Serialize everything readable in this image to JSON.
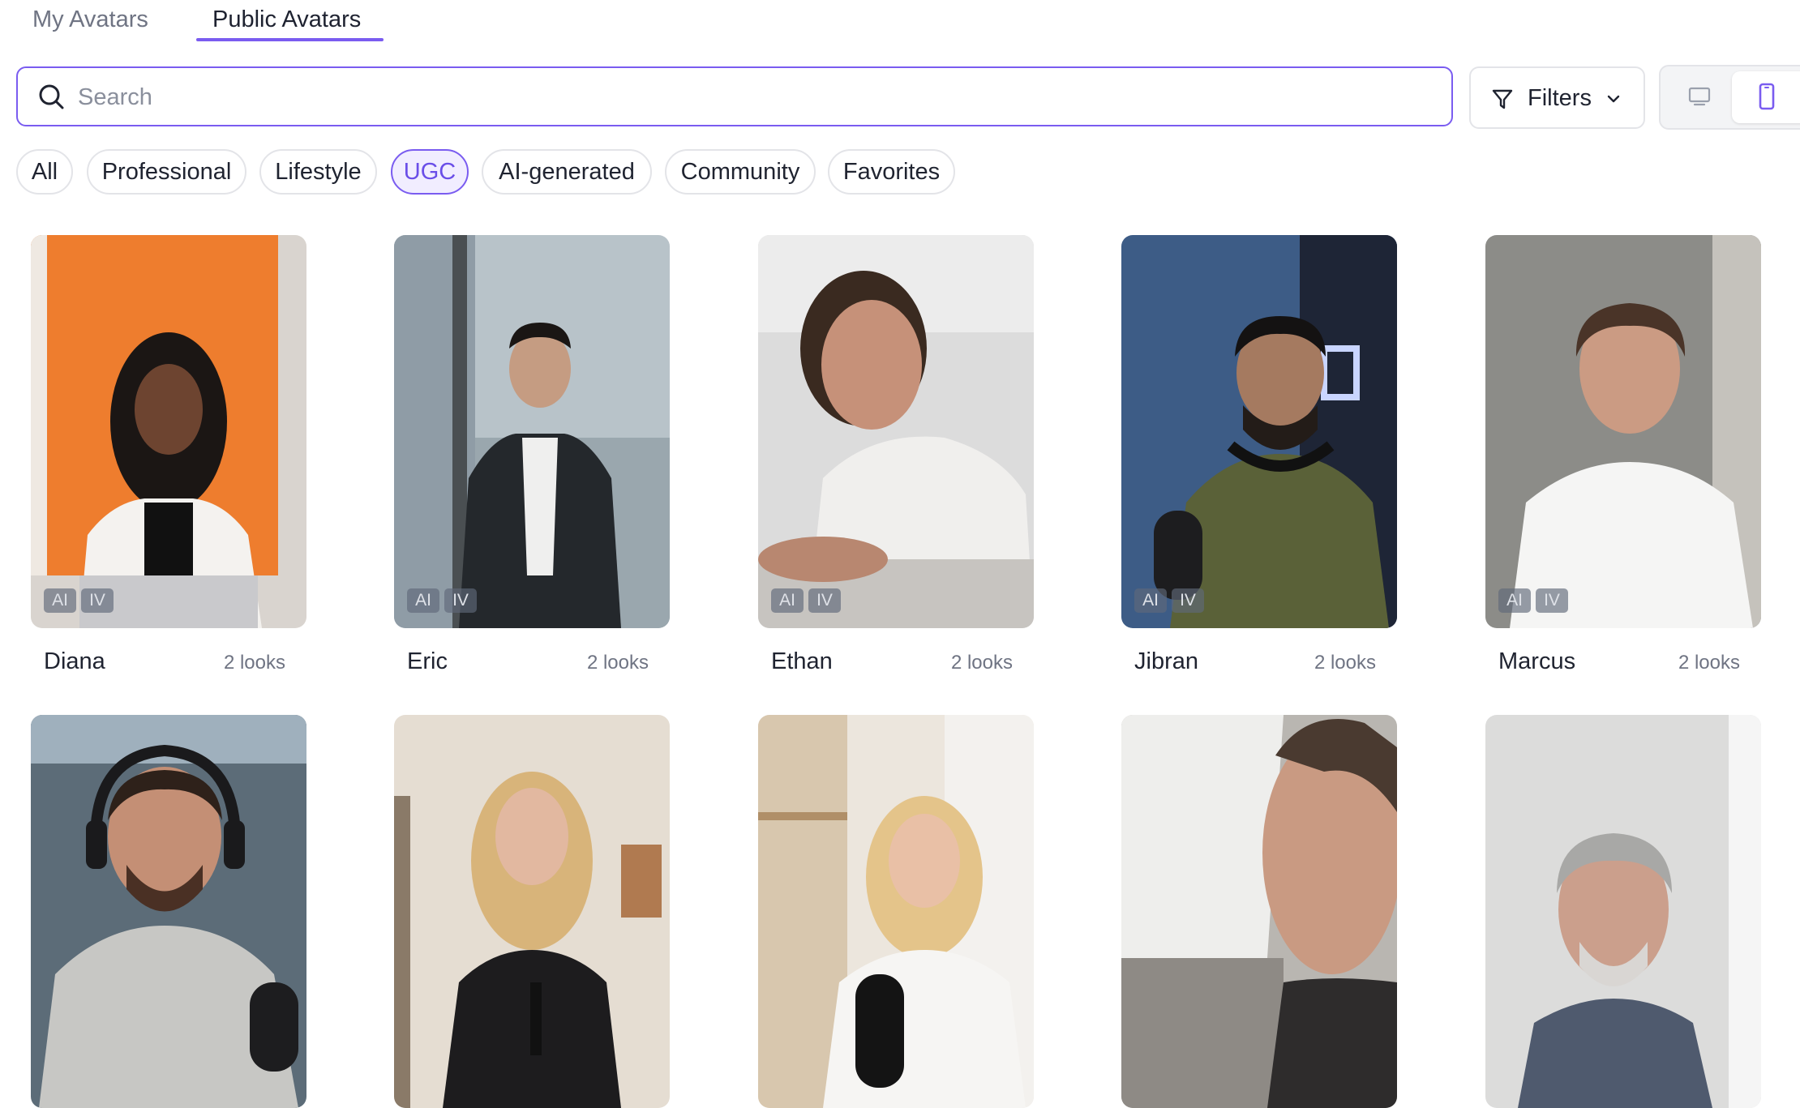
{
  "tabs": [
    {
      "label": "My Avatars",
      "active": false
    },
    {
      "label": "Public Avatars",
      "active": true
    }
  ],
  "search": {
    "placeholder": "Search",
    "value": ""
  },
  "filters_button": {
    "label": "Filters"
  },
  "view_toggle": {
    "options": [
      "desktop-icon",
      "mobile-icon"
    ],
    "selected": "mobile-icon"
  },
  "chips": [
    {
      "label": "All"
    },
    {
      "label": "Professional"
    },
    {
      "label": "Lifestyle"
    },
    {
      "label": "UGC",
      "selected": true
    },
    {
      "label": "AI-generated"
    },
    {
      "label": "Community"
    },
    {
      "label": "Favorites"
    }
  ],
  "badges": {
    "ai": "AI",
    "iv": "IV"
  },
  "avatars": [
    {
      "name": "Diana",
      "looks": "2 looks"
    },
    {
      "name": "Eric",
      "looks": "2 looks"
    },
    {
      "name": "Ethan",
      "looks": "2 looks"
    },
    {
      "name": "Jibran",
      "looks": "2 looks"
    },
    {
      "name": "Marcus",
      "looks": "2 looks"
    },
    {
      "name": "",
      "looks": ""
    },
    {
      "name": "",
      "looks": ""
    },
    {
      "name": "",
      "looks": ""
    },
    {
      "name": "",
      "looks": ""
    },
    {
      "name": "",
      "looks": ""
    }
  ],
  "colors": {
    "accent": "#7a5cf0",
    "selected_chip_bg": "#f1edff"
  }
}
